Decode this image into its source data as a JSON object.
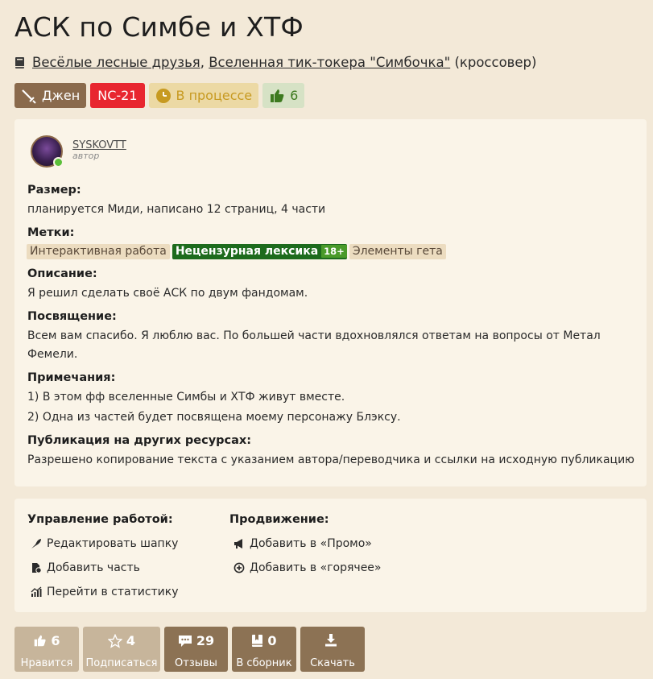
{
  "work": {
    "title": "АСК по Симбе и ХТФ",
    "fandom1": "Весёлые лесные друзья",
    "sep": ", ",
    "fandom2": "Вселенная тик-токера \"Симбочка\"",
    "crossover": " (кроссовер)"
  },
  "badges": {
    "direction": "Джен",
    "rating": "NC-21",
    "status": "В процессе",
    "likes": "6"
  },
  "author": {
    "name": "SYSKOVTT",
    "role": "автор"
  },
  "sections": {
    "size_h": "Размер:",
    "size_t": "планируется Миди, написано 12 страниц, 4 части",
    "tags_h": "Метки:",
    "tags": {
      "t1": "Интерактивная работа",
      "t2": "Нецензурная лексика",
      "t2_age": "18+",
      "t3": "Элементы гета"
    },
    "desc_h": "Описание:",
    "desc_t": "Я решил сделать своё АСК по двум фандомам.",
    "ded_h": "Посвящение:",
    "ded_t1": "Всем вам спасибо. Я люблю вас. По большей части вдохновлялся ответам на вопросы от Метал",
    "ded_t2": "Фемели.",
    "notes_h": "Примечания:",
    "notes_t1": "1) В этом фф вселенные Симбы и ХТФ живут вместе.",
    "notes_t2": "2) Одна из частей будет посвящена моему персонажу Блэксу.",
    "pub_h": "Публикация на других ресурсах:",
    "pub_t": "Разрешено копирование текста с указанием автора/переводчика и ссылки на исходную публикацию"
  },
  "manage": {
    "work_h": "Управление работой:",
    "edit": "Редактировать шапку",
    "add_part": "Добавить часть",
    "stats": "Перейти в статистику",
    "promo_h": "Продвижение:",
    "promo": "Добавить в «Промо»",
    "hot": "Добавить в «горячее»"
  },
  "buttons": {
    "like_count": "6",
    "like_label": "Нравится",
    "sub_count": "4",
    "sub_label": "Подписаться",
    "rev_count": "29",
    "rev_label": "Отзывы",
    "col_count": "0",
    "col_label": "В сборник",
    "dl_label": "Скачать"
  },
  "colors": {
    "background": "#f3e9d8",
    "card": "#faf4e8",
    "rating_red": "#e8262f",
    "brown": "#8a6a4c",
    "green_tag": "#1d6b1d"
  }
}
